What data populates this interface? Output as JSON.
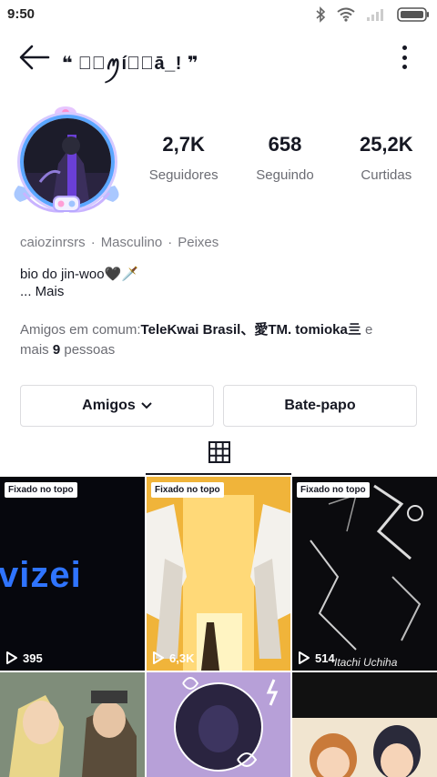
{
  "status_bar": {
    "time": "9:50"
  },
  "header": {
    "name": "❝ ⃟⃟ꪑí⃟⃟ā_! ❞"
  },
  "stats": [
    {
      "value": "2,7K",
      "label": "Seguidores"
    },
    {
      "value": "658",
      "label": "Seguindo"
    },
    {
      "value": "25,2K",
      "label": "Curtidas"
    }
  ],
  "meta": {
    "username": "caiozinrsrs",
    "gender": "Masculino",
    "sign": "Peixes"
  },
  "bio": {
    "text": "bio do jin-woo🖤🗡️",
    "more": "...  Mais"
  },
  "mutual": {
    "prefix": "Amigos em comum:",
    "friends": "TeleKwai Brasil、愛TM.  tomioka亖",
    "suffix_a": " e",
    "suffix_b": "mais ",
    "count": "9",
    "suffix_c": " pessoas"
  },
  "buttons": {
    "friends": "Amigos",
    "chat": "Bate-papo"
  },
  "videos": [
    {
      "pinned": "Fixado no topo",
      "views": "395",
      "overlay": "vizei"
    },
    {
      "pinned": "Fixado no topo",
      "views": "6,3K"
    },
    {
      "pinned": "Fixado no topo",
      "views": "514",
      "signature": "Itachi Uchiha"
    }
  ],
  "colors": {
    "accent_blue": "#2f74ff",
    "avatar_ring": "#5aa6ff",
    "text": "#161823",
    "secondary": "#6b6c73"
  },
  "icons": [
    "back-arrow-icon",
    "more-vertical-icon",
    "chevron-down-icon",
    "grid-icon",
    "play-icon"
  ]
}
